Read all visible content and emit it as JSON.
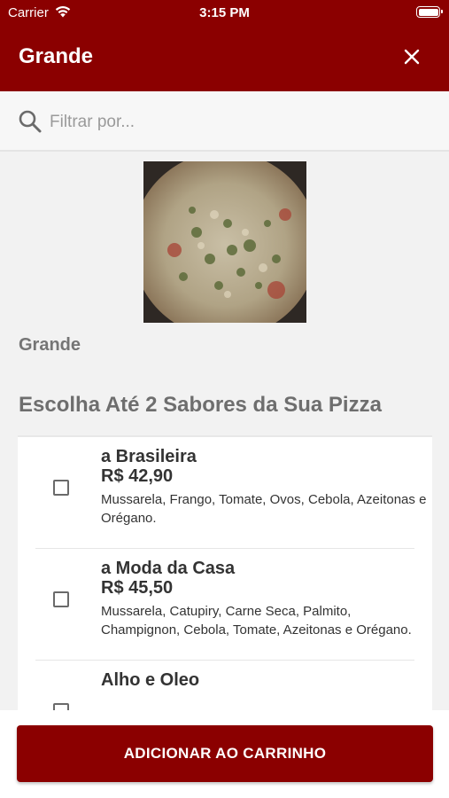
{
  "status_bar": {
    "carrier": "Carrier",
    "time": "3:15 PM"
  },
  "header": {
    "title": "Grande",
    "close_icon": "close-icon",
    "background_color": "#8b0000"
  },
  "search": {
    "placeholder": "Filtrar por...",
    "value": "",
    "icon": "search-icon"
  },
  "product": {
    "name": "Grande",
    "image": "pizza-photo"
  },
  "section": {
    "title": "Escolha Até 2 Sabores da Sua Pizza"
  },
  "options": [
    {
      "name": "a Brasileira",
      "price": "R$ 42,90",
      "description": "Mussarela, Frango, Tomate, Ovos, Cebola, Azeitonas e Orégano.",
      "checked": false
    },
    {
      "name": "a Moda da Casa",
      "price": "R$ 45,50",
      "description": "Mussarela, Catupiry, Carne Seca, Palmito, Champignon, Cebola, Tomate, Azeitonas e Orégano.",
      "checked": false
    },
    {
      "name": "Alho e Oleo",
      "price": "",
      "description": "",
      "checked": false
    }
  ],
  "footer": {
    "add_to_cart_label": "ADICIONAR AO CARRINHO"
  }
}
